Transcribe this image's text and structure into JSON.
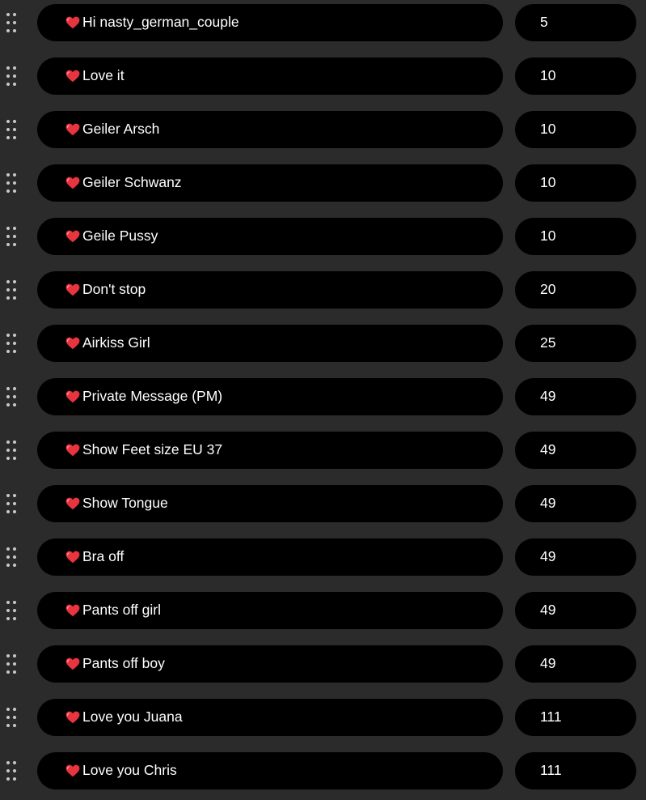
{
  "colors": {
    "background": "#2b2b2b",
    "pill": "#000000",
    "text": "#ffffff",
    "heart": "#e8343e",
    "handle_dots": "#c8c8c8"
  },
  "icons": {
    "row_icon": "heart-icon",
    "handle_icon": "drag-handle-icon"
  },
  "tip_menu": {
    "items": [
      {
        "label": "Hi nasty_german_couple",
        "price": "5"
      },
      {
        "label": "Love it",
        "price": "10"
      },
      {
        "label": "Geiler Arsch",
        "price": "10"
      },
      {
        "label": "Geiler Schwanz",
        "price": "10"
      },
      {
        "label": "Geile Pussy",
        "price": "10"
      },
      {
        "label": "Don't stop",
        "price": "20"
      },
      {
        "label": "Airkiss Girl",
        "price": "25"
      },
      {
        "label": "Private Message (PM)",
        "price": "49"
      },
      {
        "label": "Show Feet size EU 37",
        "price": "49"
      },
      {
        "label": "Show Tongue",
        "price": "49"
      },
      {
        "label": "Bra off",
        "price": "49"
      },
      {
        "label": "Pants off girl",
        "price": "49"
      },
      {
        "label": "Pants off boy",
        "price": "49"
      },
      {
        "label": "Love you Juana",
        "price": "111"
      },
      {
        "label": "Love you Chris",
        "price": "111"
      }
    ]
  }
}
